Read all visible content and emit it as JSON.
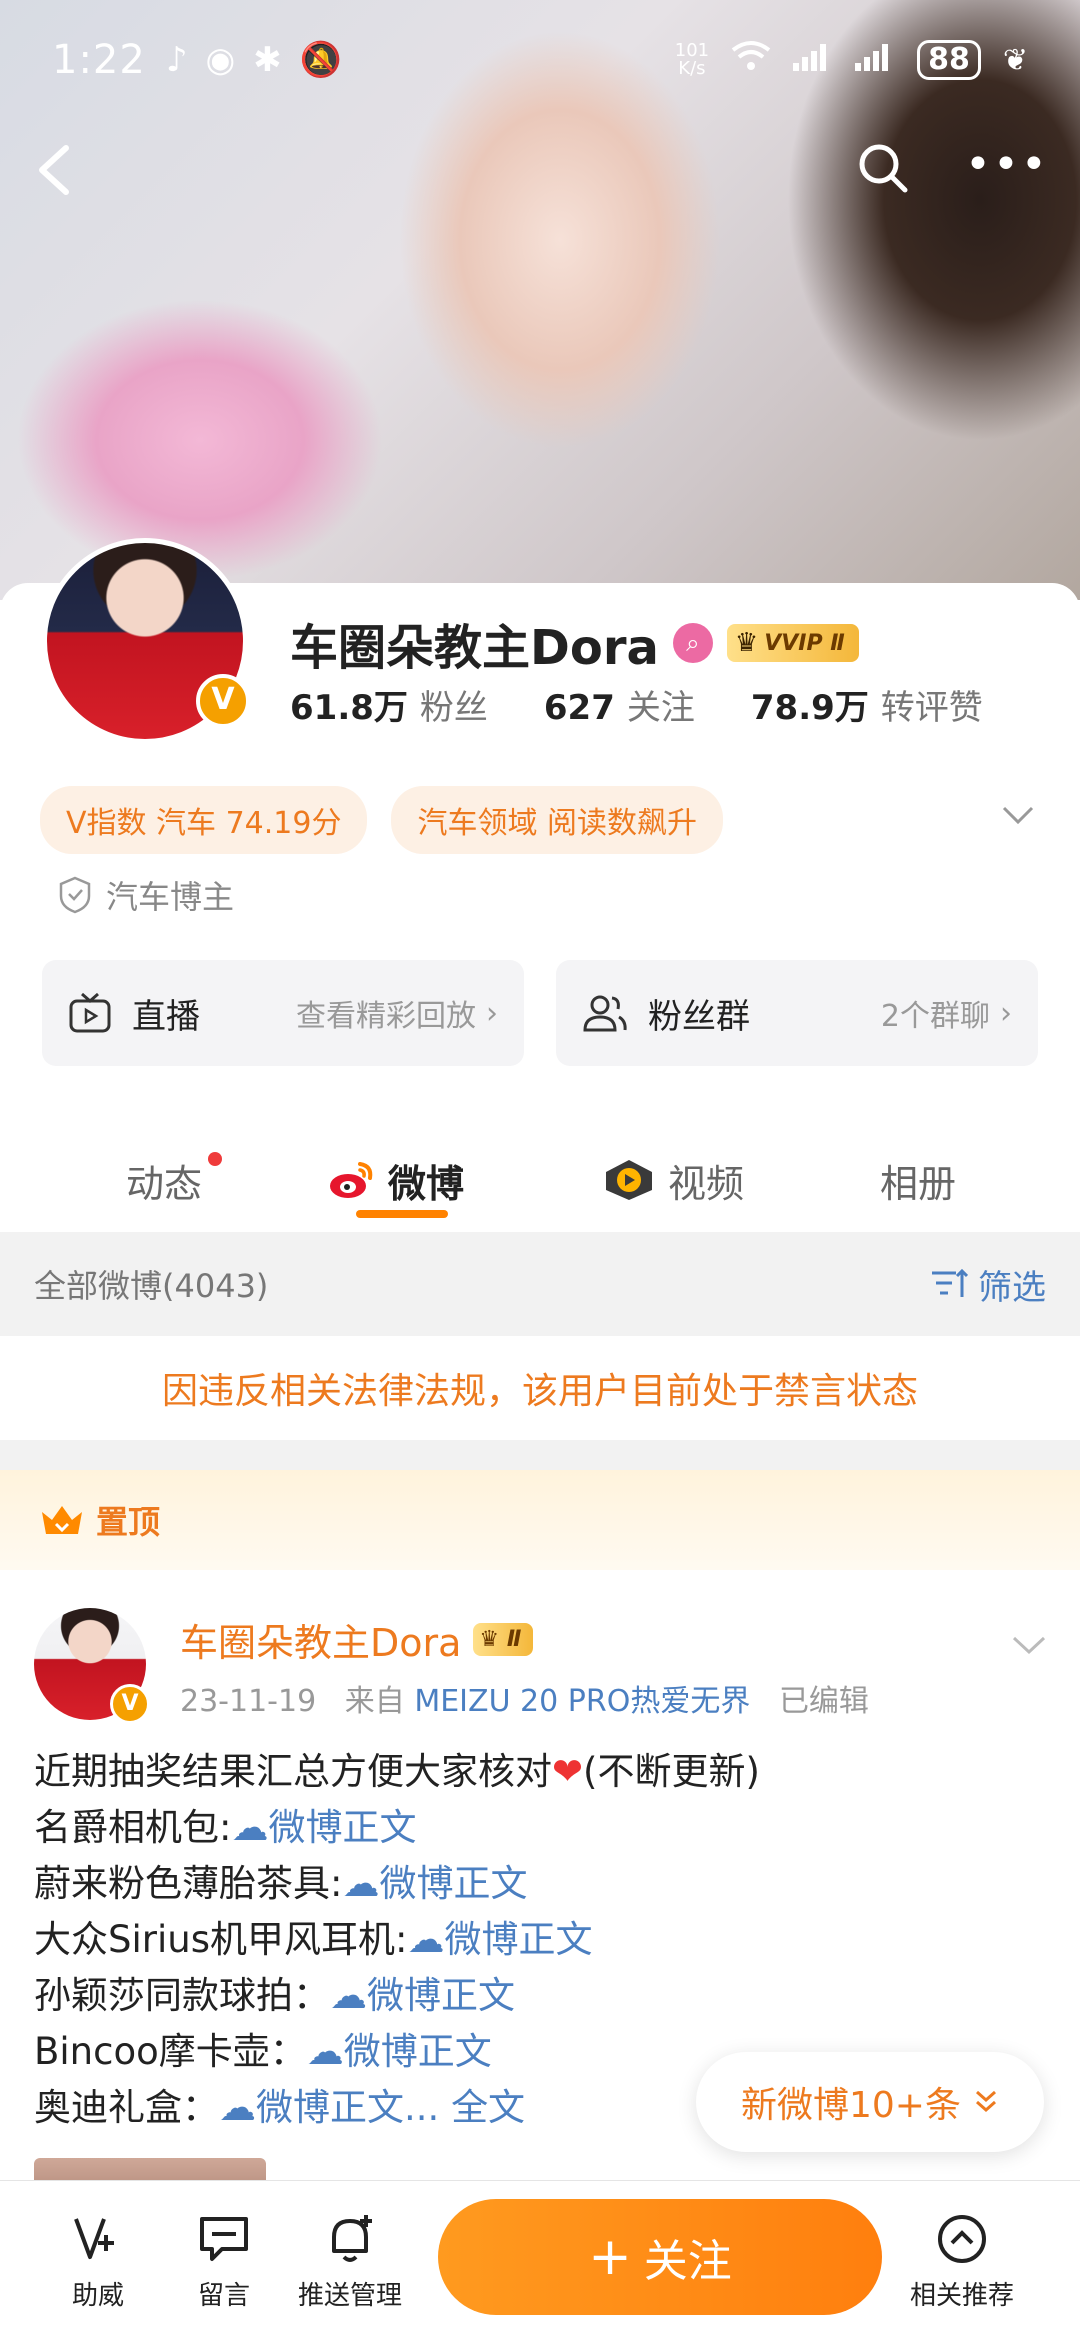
{
  "status_bar": {
    "time": "1:22",
    "speed_top": "101",
    "speed_bottom": "K/s",
    "signal_label": "6",
    "battery": "88"
  },
  "profile": {
    "name": "车圈朵教主Dora",
    "vip_badge": "VVIP Ⅱ",
    "verified_badge": "V",
    "stats": [
      {
        "num": "61.8万",
        "label": "粉丝"
      },
      {
        "num": "627",
        "label": "关注"
      },
      {
        "num": "78.9万",
        "label": "转评赞"
      }
    ],
    "tags": [
      "V指数 汽车 74.19分",
      "汽车领域 阅读数飙升"
    ],
    "certification": "汽车博主"
  },
  "quick_entries": {
    "live": {
      "title": "直播",
      "sub": "查看精彩回放"
    },
    "fans": {
      "title": "粉丝群",
      "sub": "2个群聊"
    }
  },
  "tabs": [
    {
      "label": "动态"
    },
    {
      "label": "微博"
    },
    {
      "label": "视频"
    },
    {
      "label": "相册"
    }
  ],
  "filter_bar": {
    "total": "全部微博(4043)",
    "filter": "筛选"
  },
  "banned_notice": "因违反相关法律法规，该用户目前处于禁言状态",
  "pinned_label": "置顶",
  "post": {
    "author": "车圈朵教主Dora",
    "badge": "Ⅱ",
    "date": "23-11-19",
    "from_label": "来自",
    "source": "MEIZU 20 PRO热爱无界",
    "edited": "已编辑",
    "line1_pre": "近期抽奖结果汇总方便大家核对",
    "line1_post": "(不断更新)",
    "items": [
      {
        "label": "名爵相机包:",
        "link": "微博正文"
      },
      {
        "label": "蔚来粉色薄胎茶具:",
        "link": "微博正文"
      },
      {
        "label": "大众Sirius机甲风耳机:",
        "link": "微博正文"
      },
      {
        "label": "孙颖莎同款球拍：",
        "link": "微博正文"
      },
      {
        "label": "Bincoo摩卡壶：",
        "link": "微博正文"
      },
      {
        "label": "奥迪礼盒：",
        "link": "微博正文..."
      }
    ],
    "full_text": "全文"
  },
  "new_posts_pill": "新微博10+条",
  "bottom_bar": {
    "items": [
      {
        "label": "助威"
      },
      {
        "label": "留言"
      },
      {
        "label": "推送管理"
      },
      {
        "label": "相关推荐"
      }
    ],
    "follow_plus": "+",
    "follow_label": "关注"
  },
  "colors": {
    "accent_orange": "#ff8200",
    "link_blue": "#4b7fc1",
    "tag_bg": "#fdf0e4"
  }
}
